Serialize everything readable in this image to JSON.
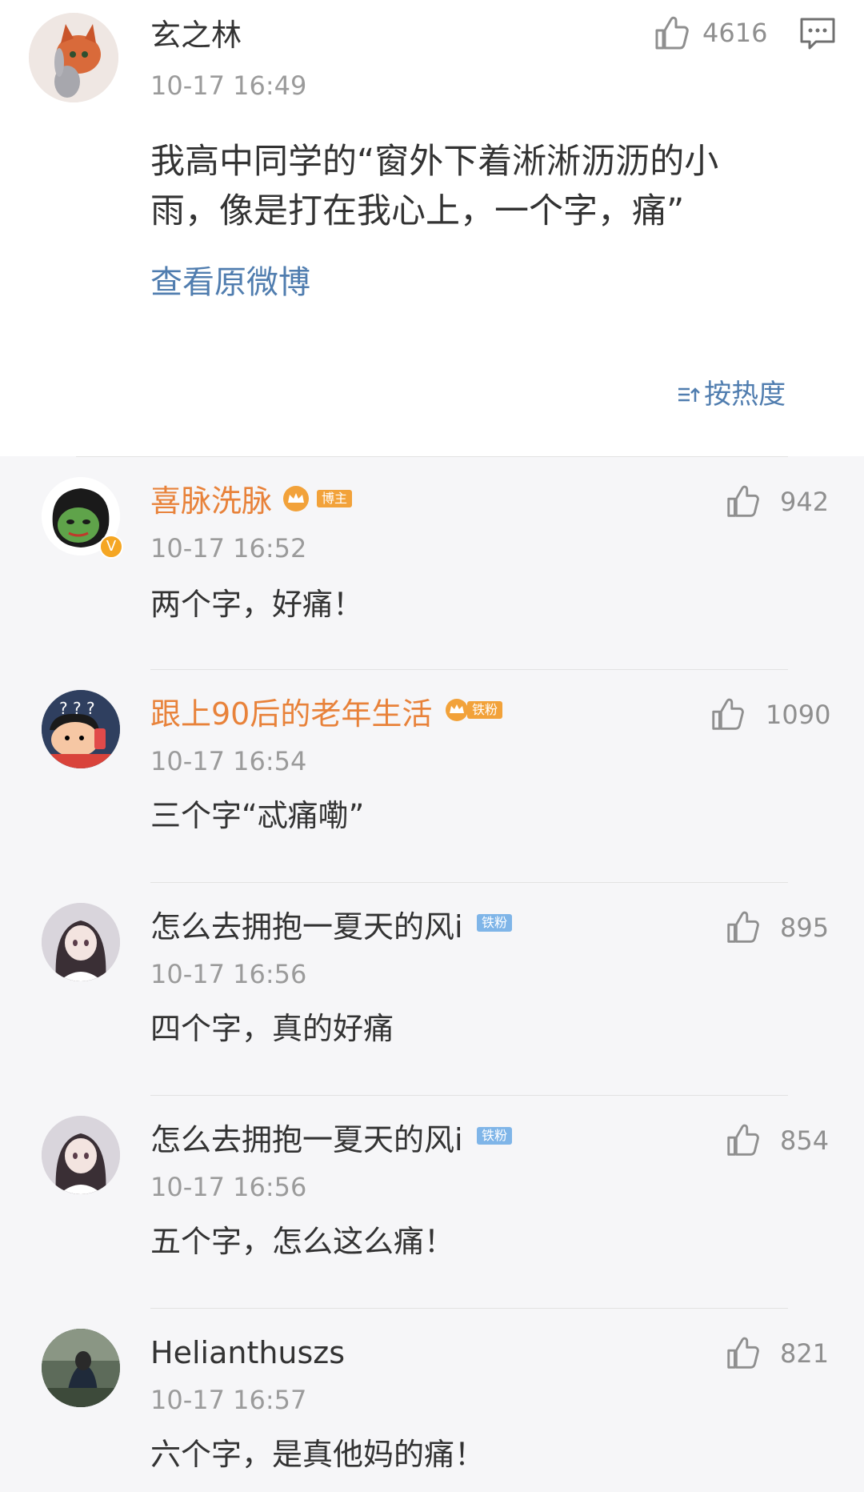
{
  "post": {
    "author": "玄之林",
    "time": "10-17 16:49",
    "text_line1": "我高中同学的“窗外下着淅淅沥沥的小",
    "text_line2": "雨，像是打在我心上，一个字，痛”",
    "view_original": "查看原微博",
    "likes": "4616",
    "sort_label": "按热度"
  },
  "comments": [
    {
      "name": "喜脉洗脉",
      "badge": "博主",
      "time": "10-17 16:52",
      "text": "两个字，好痛！",
      "likes": "942"
    },
    {
      "name": "跟上90后的老年生活",
      "badge": "铁粉",
      "time": "10-17 16:54",
      "text": "三个字“忒痛嘞”",
      "likes": "1090"
    },
    {
      "name": "怎么去拥抱一夏天的风i",
      "badge": "铁粉",
      "time": "10-17 16:56",
      "text": "四个字，真的好痛",
      "likes": "895"
    },
    {
      "name": "怎么去拥抱一夏天的风i",
      "badge": "铁粉",
      "time": "10-17 16:56",
      "text": "五个字，怎么这么痛！",
      "likes": "854"
    },
    {
      "name": "Helianthuszs",
      "time": "10-17 16:57",
      "text": "六个字，是真他妈的痛！",
      "likes": "821"
    }
  ],
  "colors": {
    "orange_name": "#e8823a",
    "link_blue": "#507daf",
    "vip_badge": "#f2a23a",
    "fan_badge": "#7fb5e8"
  },
  "icons": [
    "like-icon",
    "comment-icon",
    "sort-icon",
    "crown-icon",
    "verified-icon"
  ]
}
